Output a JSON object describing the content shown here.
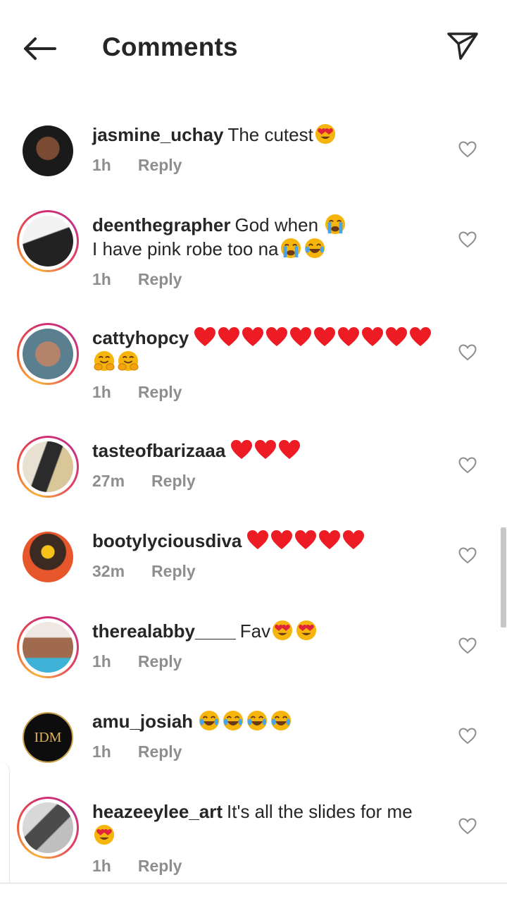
{
  "header": {
    "title": "Comments",
    "back_icon": "arrow-left-icon",
    "share_icon": "paper-plane-icon"
  },
  "comments": [
    {
      "username": "jasmine_uchay",
      "text": "The cutest",
      "emoji": [
        "love"
      ],
      "time": "1h",
      "reply": "Reply",
      "ring": false
    },
    {
      "username": "deenthegrapher",
      "text": "God when ",
      "line2": "I have pink robe too na",
      "emoji": [
        "cry"
      ],
      "emoji2": [
        "cry",
        "laugh"
      ],
      "time": "1h",
      "reply": "Reply",
      "ring": true
    },
    {
      "username": "cattyhopcy",
      "text": "",
      "hearts": 10,
      "emoji2": [
        "hug",
        "hug"
      ],
      "time": "1h",
      "reply": "Reply",
      "ring": true
    },
    {
      "username": "tasteofbarizaaa",
      "text": "",
      "hearts": 3,
      "time": "27m",
      "reply": "Reply",
      "ring": true
    },
    {
      "username": "bootylyciousdiva",
      "text": "",
      "hearts": 5,
      "time": "32m",
      "reply": "Reply",
      "ring": false
    },
    {
      "username": "therealabby____",
      "text": "Fav",
      "emoji": [
        "love",
        "love"
      ],
      "time": "1h",
      "reply": "Reply",
      "ring": true
    },
    {
      "username": "amu_josiah",
      "text": "",
      "emoji": [
        "laugh",
        "laugh",
        "laugh",
        "laugh"
      ],
      "time": "1h",
      "reply": "Reply",
      "ring": false,
      "avatar_text": "IDM"
    },
    {
      "username": "heazeeylee_art",
      "text": "It's all the slides for me",
      "emoji2": [
        "love"
      ],
      "time": "1h",
      "reply": "Reply",
      "ring": true
    }
  ],
  "colors": {
    "text": "#262626",
    "muted": "#8e8e8e",
    "heart_red": "#ed1c24",
    "emoji_yellow": "#f5b50c"
  }
}
